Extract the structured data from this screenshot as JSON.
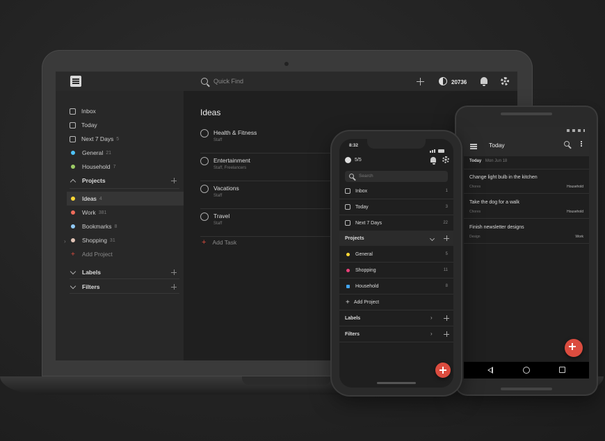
{
  "laptop": {
    "topbar": {
      "search_placeholder": "Quick Find",
      "karma": "20736"
    },
    "sidebar": {
      "items": [
        {
          "label": "Inbox",
          "count": ""
        },
        {
          "label": "Today",
          "count": ""
        },
        {
          "label": "Next 7 Days",
          "count": "5"
        },
        {
          "label": "General",
          "count": "21",
          "color": "#4fc3f7"
        },
        {
          "label": "Household",
          "count": "7",
          "color": "#9ccc65"
        }
      ],
      "projects_header": "Projects",
      "projects": [
        {
          "label": "Ideas",
          "count": "4",
          "color": "#fdd835"
        },
        {
          "label": "Work",
          "count": "381",
          "color": "#ef6c5b"
        },
        {
          "label": "Bookmarks",
          "count": "8",
          "color": "#90caf9"
        },
        {
          "label": "Shopping",
          "count": "31",
          "color": "#e0c3b5"
        }
      ],
      "add_project": "Add Project",
      "labels_header": "Labels",
      "filters_header": "Filters"
    },
    "main": {
      "title": "Ideas",
      "tasks": [
        {
          "title": "Health & Fitness",
          "sub": "Staff"
        },
        {
          "title": "Entertainment",
          "sub": "Staff, Freelancers"
        },
        {
          "title": "Vacations",
          "sub": "Staff"
        },
        {
          "title": "Travel",
          "sub": "Staff"
        }
      ],
      "add_task": "Add Task"
    }
  },
  "iphone": {
    "time": "8:32",
    "karma": "5/5",
    "search_placeholder": "Search",
    "rows": [
      {
        "label": "Inbox",
        "count": "1"
      },
      {
        "label": "Today",
        "count": "3"
      },
      {
        "label": "Next 7 Days",
        "count": "22"
      }
    ],
    "projects_header": "Projects",
    "projects": [
      {
        "label": "General",
        "count": "5",
        "color": "#fdd835"
      },
      {
        "label": "Shopping",
        "count": "11",
        "color": "#ec407a"
      },
      {
        "label": "Household",
        "count": "8",
        "color": "#42a5f5"
      }
    ],
    "add_project": "Add Project",
    "labels_header": "Labels",
    "filters_header": "Filters"
  },
  "android": {
    "title": "Today",
    "subheader_day": "Today",
    "subheader_date": "Mon Jun 18",
    "tasks": [
      {
        "title": "Change light bulb in the kitchen",
        "sub": "Chores",
        "project": "Household"
      },
      {
        "title": "Take the dog for a walk",
        "sub": "Chores",
        "project": "Household"
      },
      {
        "title": "Finish newsletter designs",
        "sub": "Design",
        "project": "Work"
      }
    ]
  },
  "colors": {
    "accent": "#db4c3f",
    "background": "#232323"
  }
}
